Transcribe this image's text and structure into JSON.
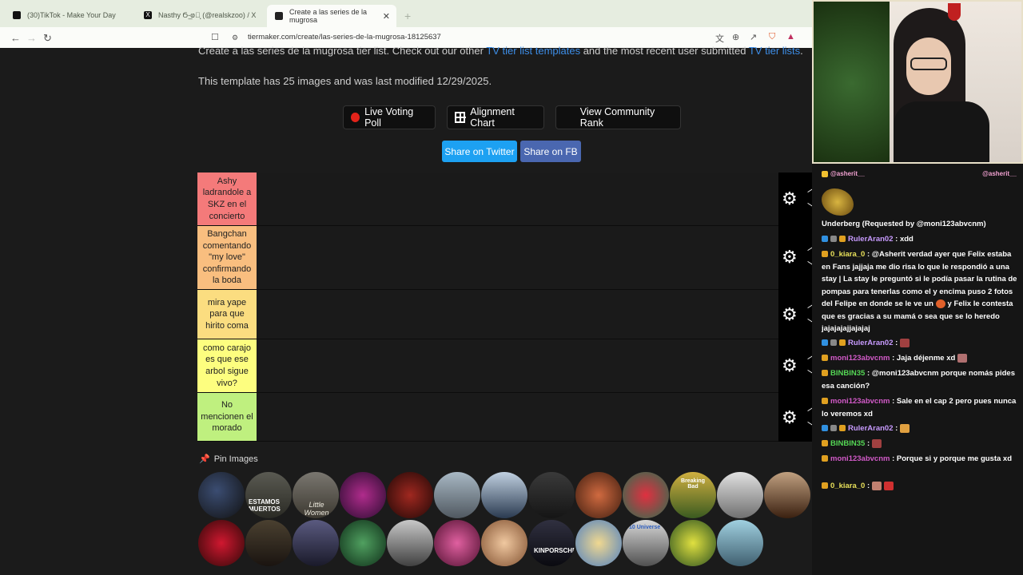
{
  "browser": {
    "tabs": [
      {
        "title": "(30)TikTok - Make Your Day",
        "favicon": "tiktok-icon"
      },
      {
        "title": "Nasthy Ϭ-̲ⱷ⃓̝ (@realskzoo) / X",
        "favicon": "x-icon"
      },
      {
        "title": "Create a las series de la mugrosa",
        "favicon": "tiermaker-icon",
        "active": true
      }
    ],
    "new_tab": "+",
    "url": "tiermaker.com/create/las-series-de-la-mugrosa-18125637",
    "nav": {
      "back": "←",
      "forward": "→",
      "reload": "↻"
    }
  },
  "page": {
    "intro_pre": "Create a las series de la mugrosa tier list. Check out our other ",
    "intro_link1": "TV tier list templates",
    "intro_mid": " and the most recent user submitted ",
    "intro_link2": "TV tier lists",
    "intro_post": ".",
    "template_info": "This template has 25 images and was last modified 12/29/2025.",
    "buttons": {
      "live_voting": "Live Voting Poll",
      "alignment": "Alignment Chart",
      "community_rank": "View Community Rank",
      "share_twitter": "Share on Twitter",
      "share_fb": "Share on FB"
    },
    "tiers": [
      {
        "label": "Ashy ladrandole a SKZ en el concierto",
        "color": "#f47a7a"
      },
      {
        "label": "Bangchan comentando \"my love\" confirmando la boda",
        "color": "#f9be7f"
      },
      {
        "label": "mira yape para que hirito coma",
        "color": "#fbdd80"
      },
      {
        "label": "como carajo es que ese arbol sigue vivo?",
        "color": "#fdfe7f"
      },
      {
        "label": "No mencionen el morado",
        "color": "#bff07f"
      }
    ],
    "pin_images": "Pin Images",
    "thumb_labels": [
      "ESTAMOS MUERTOS",
      "Little Women",
      "Breaking Bad",
      "KINPORSCHE",
      "10 Universe"
    ]
  },
  "chat": [
    {
      "user": "@asherit__",
      "text": ""
    },
    {
      "user": "",
      "text": "Underberg (Requested by @moni123abvcnm)"
    },
    {
      "user": "RulerAran02",
      "text": ": xdd",
      "color": "#c89bff"
    },
    {
      "user": "0_kiara_0",
      "text": ": @Asherit verdad ayer que Felix estaba en Fans jajjaja me dio risa lo que le respondió a una stay | La stay le preguntó si le podía pasar la rutina de pompas para tenerlas como el y encima puso 2 fotos del Felipe en donde se le ve un",
      "tail": " y Felix le contesta que es gracias a su mamá o sea que se lo heredo jajajajajjajajaj",
      "color": "#e8e05a"
    },
    {
      "user": "RulerAran02",
      "text": ":",
      "color": "#c89bff"
    },
    {
      "user": "moni123abvcnm",
      "text": ": Jaja déjenme xd",
      "color": "#d25ac8"
    },
    {
      "user": "BINBIN35",
      "text": ": @moni123abvcnm porque nomás pides esa canción?",
      "color": "#55d655"
    },
    {
      "user": "moni123abvcnm",
      "text": ": Sale en el cap 2 pero pues nunca lo veremos xd",
      "color": "#d25ac8"
    },
    {
      "user": "RulerAran02",
      "text": ":",
      "color": "#c89bff"
    },
    {
      "user": "BINBIN35",
      "text": ":",
      "color": "#55d655"
    },
    {
      "user": "moni123abvcnm",
      "text": ": Porque si y porque me gusta xd",
      "color": "#d25ac8"
    },
    {
      "user": "0_kiara_0",
      "text": ":",
      "color": "#e8e05a"
    }
  ]
}
